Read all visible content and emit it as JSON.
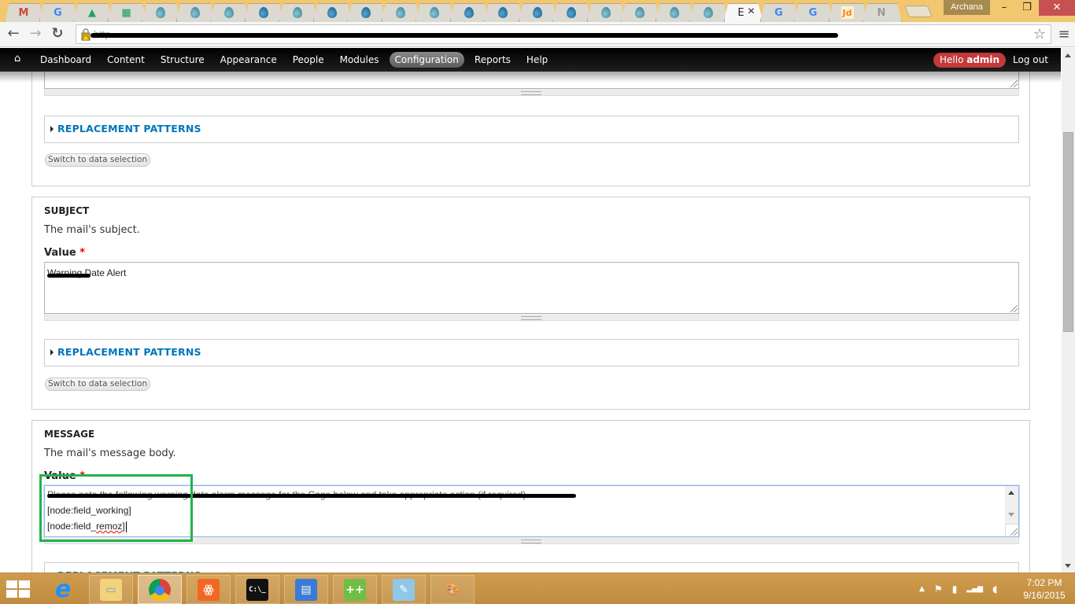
{
  "browser": {
    "tabs": [
      {
        "icon": "gmail-icon",
        "glyph": "M",
        "color": "#d44638"
      },
      {
        "icon": "google-icon",
        "glyph": "G",
        "color": "#4285f4"
      },
      {
        "icon": "google-drive-icon",
        "glyph": "▲",
        "color": "#1fa463"
      },
      {
        "icon": "google-sheets-icon",
        "glyph": "▦",
        "color": "#0f9d58"
      },
      {
        "icon": "drupal-drop-icon",
        "glyph": "drop"
      },
      {
        "icon": "drupal-drop-icon",
        "glyph": "drop"
      },
      {
        "icon": "drupal-drop-icon",
        "glyph": "drop"
      },
      {
        "icon": "drupal-logo-icon",
        "glyph": "dropdark"
      },
      {
        "icon": "drupal-drop-icon",
        "glyph": "drop"
      },
      {
        "icon": "drupal-logo-icon",
        "glyph": "dropdark"
      },
      {
        "icon": "drupal-logo-icon",
        "glyph": "dropdark"
      },
      {
        "icon": "drupal-drop-icon",
        "glyph": "drop"
      },
      {
        "icon": "drupal-drop-icon",
        "glyph": "drop"
      },
      {
        "icon": "drupal-logo-icon",
        "glyph": "dropdark"
      },
      {
        "icon": "drupal-logo-icon",
        "glyph": "dropdark"
      },
      {
        "icon": "drupal-logo-icon",
        "glyph": "dropdark"
      },
      {
        "icon": "drupal-logo-icon",
        "glyph": "dropdark"
      },
      {
        "icon": "drupal-drop-icon",
        "glyph": "drop"
      },
      {
        "icon": "drupal-drop-icon",
        "glyph": "drop"
      },
      {
        "icon": "drupal-drop-icon",
        "glyph": "drop"
      },
      {
        "icon": "drupal-drop-icon",
        "glyph": "drop"
      },
      {
        "icon": "active-tab",
        "glyph": "E",
        "active": true
      },
      {
        "icon": "google-icon",
        "glyph": "G",
        "color": "#4285f4"
      },
      {
        "icon": "google-icon",
        "glyph": "G",
        "color": "#4285f4"
      },
      {
        "icon": "justdial-icon",
        "glyph": "Jd",
        "color": "#f58220"
      },
      {
        "icon": "tab-icon",
        "glyph": "N",
        "color": "#999"
      }
    ],
    "profile_name": "Archana",
    "url_prefix": "http",
    "window_controls": {
      "minimize": "–",
      "maximize": "❐",
      "close": "✕"
    }
  },
  "admin_toolbar": {
    "home_label": "⌂",
    "items": [
      {
        "label": "Dashboard"
      },
      {
        "label": "Content"
      },
      {
        "label": "Structure"
      },
      {
        "label": "Appearance"
      },
      {
        "label": "People"
      },
      {
        "label": "Modules"
      },
      {
        "label": "Configuration",
        "active": true
      },
      {
        "label": "Reports"
      },
      {
        "label": "Help"
      }
    ],
    "hello_prefix": "Hello ",
    "username": "admin",
    "logout_label": "Log out"
  },
  "form": {
    "top_section": {
      "replacement_patterns_label": "REPLACEMENT PATTERNS",
      "switch_button_label": "Switch to data selection"
    },
    "subject": {
      "legend": "SUBJECT",
      "description": "The mail's subject.",
      "value_label": "Value",
      "required_marker": "*",
      "value_visible_text": "Date Alert",
      "value_redacted_prefix": "Warning ",
      "replacement_patterns_label": "REPLACEMENT PATTERNS",
      "switch_button_label": "Switch to data selection"
    },
    "message": {
      "legend": "MESSAGE",
      "description": "The mail's message body.",
      "value_label": "Value",
      "required_marker": "*",
      "line1_redacted": "Please note the following warning date alarm message for the Cage below and take appropriate action (if required).",
      "line2": "[node:field_working]",
      "line3_prefix": "[node:field_",
      "line3_misspelled": "remoz",
      "line3_suffix": "]",
      "replacement_patterns_label": "REPLACEMENT PATTERNS"
    }
  },
  "taskbar": {
    "apps": [
      {
        "name": "internet-explorer-icon",
        "glyph": "e",
        "bg": "transparent",
        "color": "#1e90ff"
      },
      {
        "name": "file-explorer-icon",
        "glyph": "▭",
        "bg": "#f3d27a",
        "color": "#6aa3d8"
      },
      {
        "name": "chrome-icon",
        "glyph": "●",
        "bg": "transparent",
        "color": "#2a6fd6",
        "active": true
      },
      {
        "name": "xampp-icon",
        "glyph": "ꙮ",
        "bg": "#f26722",
        "color": "#fff"
      },
      {
        "name": "command-prompt-icon",
        "glyph": "C:\\_",
        "bg": "#111",
        "color": "#fff"
      },
      {
        "name": "control-panel-icon",
        "glyph": "▤",
        "bg": "#3a7bd5",
        "color": "#fff"
      },
      {
        "name": "notepad-plus-plus-icon",
        "glyph": "++",
        "bg": "#6fbf45",
        "color": "#fff"
      },
      {
        "name": "notepad-icon",
        "glyph": "✎",
        "bg": "#8fc7e8",
        "color": "#fff"
      },
      {
        "name": "paint-icon",
        "glyph": "🎨",
        "bg": "transparent",
        "color": "#fff"
      }
    ],
    "tray": {
      "show_hidden": "▲",
      "action_center": "⚑",
      "power": "▮",
      "network": "▂▄▆",
      "volume": "◖"
    },
    "clock_time": "7:02 PM",
    "clock_date": "9/16/2015"
  }
}
